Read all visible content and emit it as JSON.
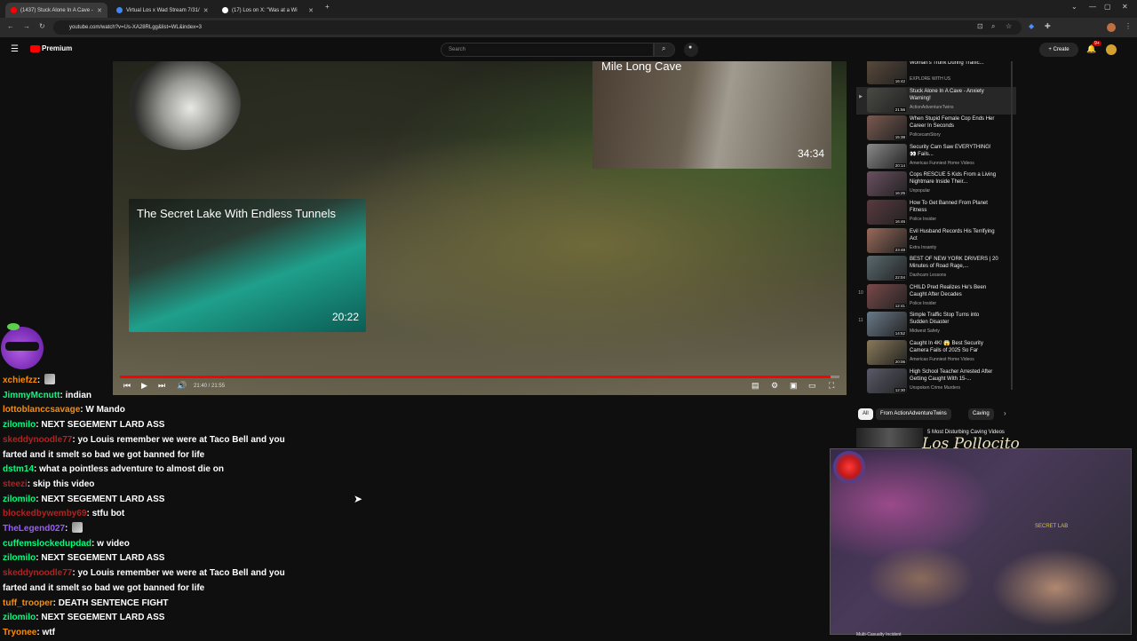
{
  "browser": {
    "tabs": [
      {
        "label": "(1437) Stuck Alone In A Cave -",
        "icon_color": "#ff0000",
        "active": true
      },
      {
        "label": "Virtual Los x Wad Stream 7/31/",
        "icon_color": "#4285f4",
        "active": false
      },
      {
        "label": "(17) Los on X: \"Was at a Wi",
        "icon_color": "#ffffff",
        "active": false
      }
    ],
    "url": "youtube.com/watch?v=Us-XA28RLgg&list=WL&index=3"
  },
  "youtube": {
    "logo_text": "Premium",
    "search_placeholder": "Search",
    "create_label": "Create",
    "notification_count": "9+"
  },
  "player": {
    "endcard_left": {
      "title": "The Secret Lake With Endless Tunnels",
      "duration": "20:22"
    },
    "endcard_right": {
      "title": "Mile Long Cave",
      "duration": "34:34"
    },
    "time": "21:40 / 21:55",
    "progress": 0.988,
    "accent": "#ff0000"
  },
  "playlist": [
    {
      "num": "",
      "title": "Woman's Trunk During Traffic...",
      "channel": "EXPLORE WITH US",
      "duration": "16:42",
      "thumb": "#5a4a3a"
    },
    {
      "num": "▶",
      "title": "Stuck Alone In A Cave - Anxiety Warning!",
      "channel": "ActionAdventureTwins",
      "duration": "21:56",
      "thumb": "#4a4a44",
      "active": true
    },
    {
      "num": "",
      "title": "When Stupid Female Cop Ends Her Career In Seconds",
      "channel": "PolicecamStory",
      "duration": "15:38",
      "thumb": "#7a5a50"
    },
    {
      "num": "",
      "title": "Security Cam Saw EVERYTHING! 👀 Fails...",
      "channel": "Americas Funniest Home Videos",
      "duration": "20:14",
      "thumb": "#8a8a8a"
    },
    {
      "num": "",
      "title": "Cops RESCUE 5 Kids From a Living Nightmare Inside Their...",
      "channel": "Unpopular",
      "duration": "16:25",
      "thumb": "#6a5060"
    },
    {
      "num": "",
      "title": "How To Get Banned From Planet Fitness",
      "channel": "Police Insider",
      "duration": "16:46",
      "thumb": "#5a3a40"
    },
    {
      "num": "",
      "title": "Evil Husband Records His Terrifying Act",
      "channel": "Extra Insanity",
      "duration": "23:48",
      "thumb": "#9a6a5a"
    },
    {
      "num": "",
      "title": "BEST OF NEW YORK DRIVERS | 20 Minutes of Road Rage,...",
      "channel": "Dashcam Lessons",
      "duration": "22:04",
      "thumb": "#5a6a70"
    },
    {
      "num": "10",
      "title": "CHILD Pred Realizes He's Been Caught After Decades",
      "channel": "Police Insider",
      "duration": "12:41",
      "thumb": "#7a4a4a"
    },
    {
      "num": "11",
      "title": "Simple Traffic Stop Turns into Sudden Disaster",
      "channel": "Midwest Safety",
      "duration": "14:52",
      "thumb": "#6a7a8a"
    },
    {
      "num": "",
      "title": "Caught In 4K! 😱 Best Security Camera Fails of 2025 So Far",
      "channel": "Americas Funniest Home Videos",
      "duration": "20:06",
      "thumb": "#8a7a5a"
    },
    {
      "num": "",
      "title": "High School Teacher Arrested After Getting Caught With 15-...",
      "channel": "Unspoken Crime Murders",
      "duration": "12:30",
      "thumb": "#5a5a6a"
    },
    {
      "num": "",
      "title": "Entitled Customer Refuses to...",
      "channel": "",
      "duration": "",
      "thumb": "#6a5a4a"
    }
  ],
  "chips": [
    "All",
    "From ActionAdventureTwins",
    "Caving"
  ],
  "recommended": {
    "title": "5 Most Disturbing Caving Videos",
    "bottom_title": "Multi-Casualty Incident"
  },
  "overlay": {
    "signature": "Los Pollocito",
    "badge": "SECRET LAB"
  },
  "chat": [
    {
      "user": "xchiefzz",
      "color": "#ff8c00",
      "text": "",
      "emoji": true
    },
    {
      "user": "JimmyMcnutt",
      "color": "#00ff7f",
      "text": "indian"
    },
    {
      "user": "lottoblanccsavage",
      "color": "#ff8c00",
      "text": "W Mando"
    },
    {
      "user": "zilomilo",
      "color": "#00ff7f",
      "text": "NEXT SEGEMENT LARD ASS"
    },
    {
      "user": "skeddynoodle77",
      "color": "#b22222",
      "text": "yo Louis remember we were at Taco Bell and you farted and it smelt so bad we got banned for life"
    },
    {
      "user": "dstm14",
      "color": "#00ff7f",
      "text": "what a pointless adventure to almost die on"
    },
    {
      "user": "steezi",
      "color": "#b22222",
      "text": "skip this video"
    },
    {
      "user": "zilomilo",
      "color": "#00ff7f",
      "text": "NEXT SEGEMENT LARD ASS"
    },
    {
      "user": "blockedbywemby69",
      "color": "#b22222",
      "text": "stfu bot"
    },
    {
      "user": "TheLegend027",
      "color": "#9a5cff",
      "text": "",
      "emoji": true
    },
    {
      "user": "cuffemslockedupdad",
      "color": "#00ff7f",
      "text": "w video"
    },
    {
      "user": "zilomilo",
      "color": "#00ff7f",
      "text": "NEXT SEGEMENT LARD ASS"
    },
    {
      "user": "skeddynoodle77",
      "color": "#b22222",
      "text": "yo Louis remember we were at Taco Bell and you farted and it smelt so bad we got banned for life"
    },
    {
      "user": "tuff_trooper",
      "color": "#ff8c00",
      "text": "DEATH SENTENCE FIGHT"
    },
    {
      "user": "zilomilo",
      "color": "#00ff7f",
      "text": "NEXT SEGEMENT LARD ASS"
    },
    {
      "user": "Tryonee",
      "color": "#ff8c00",
      "text": "wtf"
    }
  ]
}
